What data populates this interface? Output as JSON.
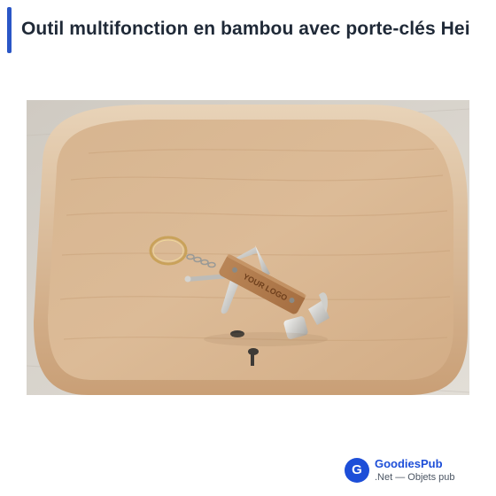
{
  "page": {
    "title": "Outil multifonction en bambou avec porte-clés Hei"
  },
  "product_image": {
    "engraving_text": "YOUR LOGO"
  },
  "brand": {
    "logo_letter": "G",
    "name": "GoodiesPub",
    "subtitle": ".Net — Objets pub"
  },
  "colors": {
    "accent": "#2a56c6",
    "brand_name": "#1d4ed8",
    "logo_bg": "#1d4ed8"
  }
}
